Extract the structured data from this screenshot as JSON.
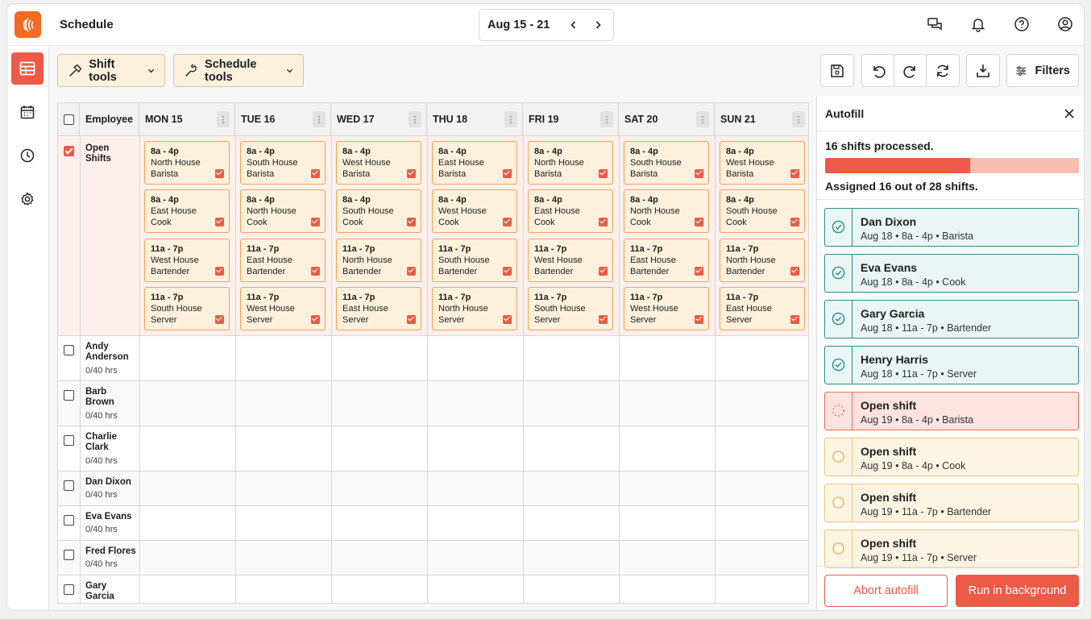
{
  "app": {
    "title": "Schedule"
  },
  "date_range": "Aug 15 - 21",
  "toolbar": {
    "shift_tools": "Shift tools",
    "schedule_tools": "Schedule tools",
    "filters": "Filters"
  },
  "grid": {
    "employee_header": "Employee",
    "days": [
      "MON 15",
      "TUE 16",
      "WED 17",
      "THU 18",
      "FRI 19",
      "SAT 20",
      "SUN 21"
    ],
    "open_shifts_label": "Open Shifts",
    "open_shifts": [
      [
        {
          "time": "8a - 4p",
          "location": "North House",
          "role": "Barista"
        },
        {
          "time": "8a - 4p",
          "location": "East House",
          "role": "Cook"
        },
        {
          "time": "11a - 7p",
          "location": "West House",
          "role": "Bartender"
        },
        {
          "time": "11a - 7p",
          "location": "South House",
          "role": "Server"
        }
      ],
      [
        {
          "time": "8a - 4p",
          "location": "South House",
          "role": "Barista"
        },
        {
          "time": "8a - 4p",
          "location": "North House",
          "role": "Cook"
        },
        {
          "time": "11a - 7p",
          "location": "East House",
          "role": "Bartender"
        },
        {
          "time": "11a - 7p",
          "location": "West House",
          "role": "Server"
        }
      ],
      [
        {
          "time": "8a - 4p",
          "location": "West House",
          "role": "Barista"
        },
        {
          "time": "8a - 4p",
          "location": "South House",
          "role": "Cook"
        },
        {
          "time": "11a - 7p",
          "location": "North House",
          "role": "Bartender"
        },
        {
          "time": "11a - 7p",
          "location": "East House",
          "role": "Server"
        }
      ],
      [
        {
          "time": "8a - 4p",
          "location": "East House",
          "role": "Barista"
        },
        {
          "time": "8a - 4p",
          "location": "West House",
          "role": "Cook"
        },
        {
          "time": "11a - 7p",
          "location": "South House",
          "role": "Bartender"
        },
        {
          "time": "11a - 7p",
          "location": "North House",
          "role": "Server"
        }
      ],
      [
        {
          "time": "8a - 4p",
          "location": "North House",
          "role": "Barista"
        },
        {
          "time": "8a - 4p",
          "location": "East House",
          "role": "Cook"
        },
        {
          "time": "11a - 7p",
          "location": "West House",
          "role": "Bartender"
        },
        {
          "time": "11a - 7p",
          "location": "South House",
          "role": "Server"
        }
      ],
      [
        {
          "time": "8a - 4p",
          "location": "South House",
          "role": "Barista"
        },
        {
          "time": "8a - 4p",
          "location": "North House",
          "role": "Cook"
        },
        {
          "time": "11a - 7p",
          "location": "East House",
          "role": "Bartender"
        },
        {
          "time": "11a - 7p",
          "location": "West House",
          "role": "Server"
        }
      ],
      [
        {
          "time": "8a - 4p",
          "location": "West House",
          "role": "Barista"
        },
        {
          "time": "8a - 4p",
          "location": "South House",
          "role": "Cook"
        },
        {
          "time": "11a - 7p",
          "location": "North House",
          "role": "Bartender"
        },
        {
          "time": "11a - 7p",
          "location": "East House",
          "role": "Server"
        }
      ]
    ],
    "employees": [
      {
        "name": "Andy Anderson",
        "hours": "0/40 hrs"
      },
      {
        "name": "Barb Brown",
        "hours": "0/40 hrs"
      },
      {
        "name": "Charlie Clark",
        "hours": "0/40 hrs"
      },
      {
        "name": "Dan Dixon",
        "hours": "0/40 hrs"
      },
      {
        "name": "Eva Evans",
        "hours": "0/40 hrs"
      },
      {
        "name": "Fred Flores",
        "hours": "0/40 hrs"
      },
      {
        "name": "Gary Garcia",
        "hours": ""
      }
    ]
  },
  "autofill": {
    "title": "Autofill",
    "processed": "16 shifts processed.",
    "progress_fraction": 0.57,
    "assigned": "Assigned 16 out of 28 shifts.",
    "items": [
      {
        "name": "Dan Dixon",
        "detail": "Aug 18 • 8a - 4p • Barista",
        "status": "done"
      },
      {
        "name": "Eva Evans",
        "detail": "Aug 18 • 8a - 4p • Cook",
        "status": "done"
      },
      {
        "name": "Gary Garcia",
        "detail": "Aug 18 • 11a - 7p • Bartender",
        "status": "done"
      },
      {
        "name": "Henry Harris",
        "detail": "Aug 18 • 11a - 7p • Server",
        "status": "done"
      },
      {
        "name": "Open shift",
        "detail": "Aug 19 • 8a - 4p • Barista",
        "status": "active"
      },
      {
        "name": "Open shift",
        "detail": "Aug 19 • 8a - 4p • Cook",
        "status": "pending"
      },
      {
        "name": "Open shift",
        "detail": "Aug 19 • 11a - 7p • Bartender",
        "status": "pending"
      },
      {
        "name": "Open shift",
        "detail": "Aug 19 • 11a - 7p • Server",
        "status": "pending"
      }
    ],
    "abort_label": "Abort autofill",
    "background_label": "Run in background"
  },
  "colors": {
    "accent": "#ee5a48",
    "brand": "#f26b21",
    "done": "#2a8c8c",
    "shift_border": "#f0a25a"
  }
}
